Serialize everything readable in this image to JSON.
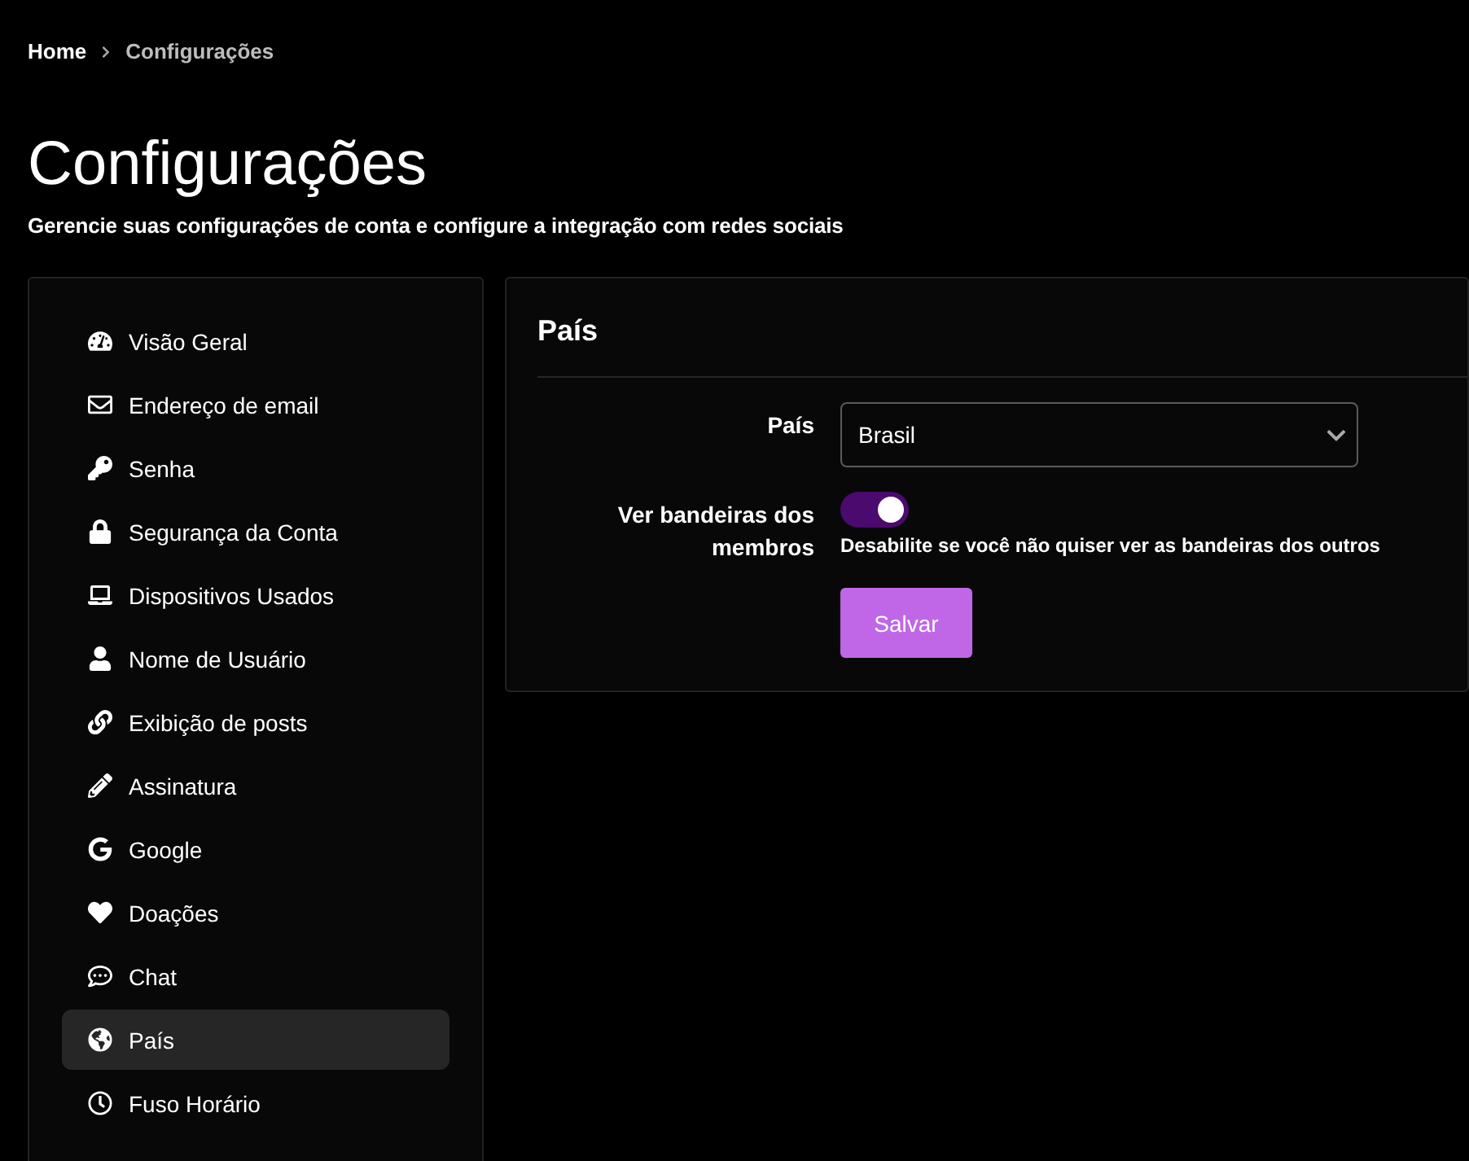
{
  "breadcrumb": [
    {
      "label": "Home",
      "current": false
    },
    {
      "label": "Configurações",
      "current": true
    }
  ],
  "title": "Configurações",
  "subtitle": "Gerencie suas configurações de conta e configure a integração com redes sociais",
  "sidebar": {
    "items": [
      {
        "label": "Visão Geral",
        "kind": "gauge",
        "selected": false
      },
      {
        "label": "Endereço de email",
        "kind": "envelope",
        "selected": false
      },
      {
        "label": "Senha",
        "kind": "key",
        "selected": false
      },
      {
        "label": "Segurança da Conta",
        "kind": "lock",
        "selected": false
      },
      {
        "label": "Dispositivos Usados",
        "kind": "laptop",
        "selected": false
      },
      {
        "label": "Nome de Usuário",
        "kind": "user",
        "selected": false
      },
      {
        "label": "Exibição de posts",
        "kind": "link",
        "selected": false
      },
      {
        "label": "Assinatura",
        "kind": "pencil",
        "selected": false
      },
      {
        "label": "Google",
        "kind": "google",
        "selected": false
      },
      {
        "label": "Doações",
        "kind": "heart",
        "selected": false
      },
      {
        "label": "Chat",
        "kind": "chat",
        "selected": false
      },
      {
        "label": "País",
        "kind": "globe",
        "selected": true
      },
      {
        "label": "Fuso Horário",
        "kind": "clock",
        "selected": false
      }
    ]
  },
  "panel": {
    "title": "País",
    "country": {
      "label": "País",
      "value": "Brasil"
    },
    "flags": {
      "label": "Ver bandeiras dos membros",
      "on": true,
      "hint": "Desabilite se você não quiser ver as bandeiras dos outros"
    },
    "save": "Salvar"
  }
}
